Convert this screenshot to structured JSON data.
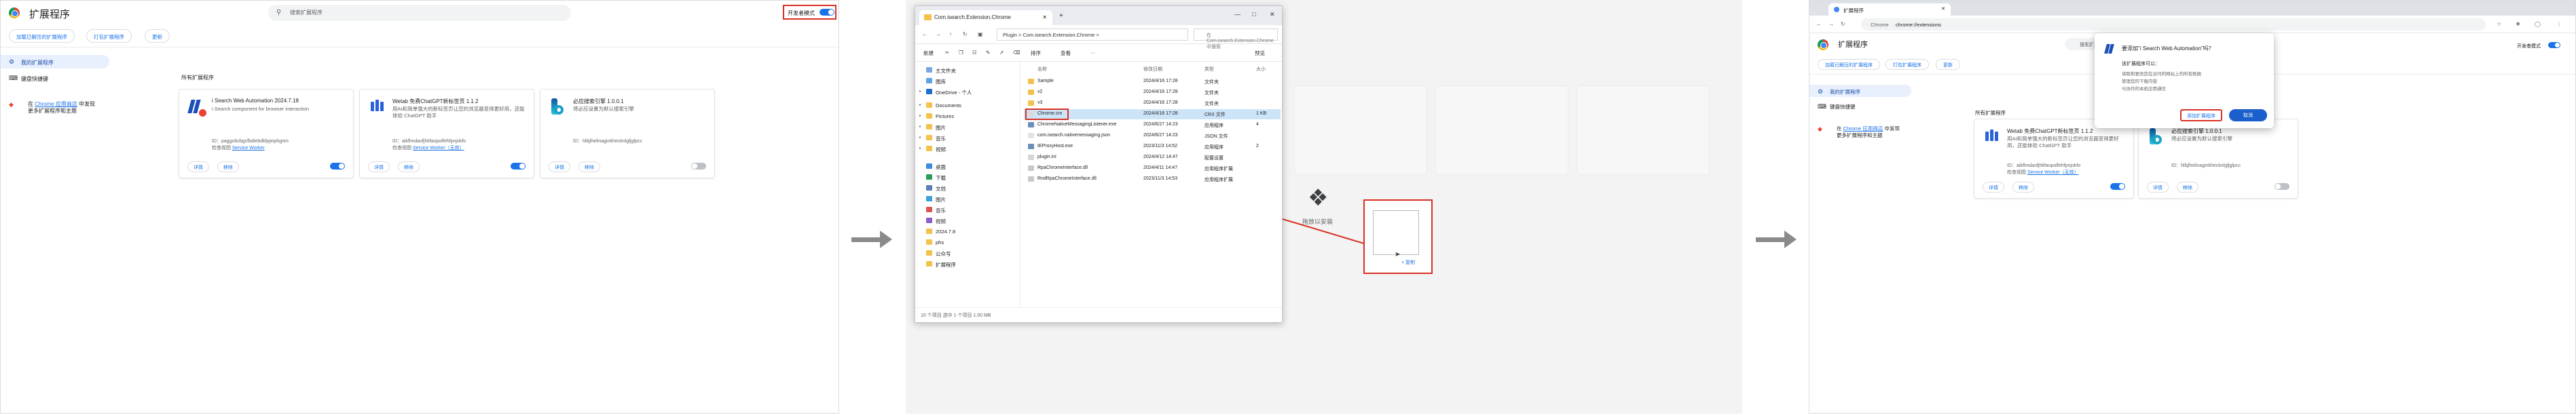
{
  "panel1": {
    "title": "扩展程序",
    "search_placeholder": "搜索扩展程序",
    "dev_mode_label": "开发者模式",
    "buttons": [
      "加载已解压的扩展程序",
      "打包扩展程序",
      "更新"
    ],
    "nav": [
      "我的扩展程序",
      "键盘快捷键"
    ],
    "store_note_line1": "在 ",
    "store_note_link": "Chrome 应用商店",
    "store_note_line1_end": " 中发现",
    "store_note_line2": "更多扩展程序和主题",
    "section_title": "所有扩展程序",
    "cards": [
      {
        "name": "i Search Web Automation  2024.7.18",
        "desc": "i Search component for browser interaction",
        "id": "ID：paggobcbgcfbdiebdkfpjeiphgnm",
        "view": "检查视图 ",
        "view_link": "Service Worker",
        "details": "详情",
        "remove": "移除",
        "enabled": true
      },
      {
        "name": "Wetab 免费ChatGPT新标签页  1.1.2",
        "desc": "用AI和简单强大的新标签页让您的浏览器变得更好用，还能体验 ChatGPT 助手",
        "id": "ID：aikflmdaofjhkfaopolfehfpnjokfo",
        "view": "检查视图 ",
        "view_link": "Service Worker（无效）",
        "details": "详情",
        "remove": "移除",
        "enabled": true
      },
      {
        "name": "必应搜索引擎  1.0.0.1",
        "desc": "将必应设置为默认搜索引擎",
        "id": "ID：hlbjlhelinaginkhecknlgfjglpcc",
        "view": "",
        "view_link": "",
        "details": "详情",
        "remove": "移除",
        "enabled": false
      }
    ]
  },
  "panel2": {
    "drop_label": "拖放以安装",
    "copy_hint": "+ 复制",
    "explorer": {
      "tab_title": "Com.isearch.Extension.Chrome",
      "path": [
        "Plugin",
        ">",
        "Com.isearch.Extension.Chrome",
        ">"
      ],
      "search_placeholder": "在 Com.isearch.Extension.Chrome 中搜索",
      "tools": [
        "新建",
        "排序",
        "查看",
        "···",
        "预览"
      ],
      "sidebar": [
        "主文件夹",
        "图库",
        "OneDrive - 个人",
        "Documents",
        "Pictures",
        "图片",
        "音乐",
        "视频",
        "桌面",
        "下载",
        "文档",
        "图片",
        "音乐",
        "视频",
        "2024.7.8",
        "phs",
        "公众号",
        "扩展程序"
      ],
      "columns": [
        "名称",
        "修改日期",
        "类型",
        "大小"
      ],
      "files": [
        {
          "name": "Sample",
          "date": "2024/4/16 17:28",
          "type": "文件夹",
          "size": ""
        },
        {
          "name": "v2",
          "date": "2024/4/16 17:28",
          "type": "文件夹",
          "size": ""
        },
        {
          "name": "v3",
          "date": "2024/4/16 17:28",
          "type": "文件夹",
          "size": ""
        },
        {
          "name": "Chrome.crx",
          "date": "2024/4/16 17:28",
          "type": "CRX 文件",
          "size": "1 KB"
        },
        {
          "name": "ChromeNativeMessagingListener.exe",
          "date": "2024/6/27 14:23",
          "type": "应用程序",
          "size": "4"
        },
        {
          "name": "com.isearch.nativemessaging.json",
          "date": "2024/6/27 14:23",
          "type": "JSON 文件",
          "size": ""
        },
        {
          "name": "IEProxyHost.exe",
          "date": "2023/11/3 14:52",
          "type": "应用程序",
          "size": "2"
        },
        {
          "name": "plugin.ini",
          "date": "2024/4/12 14:47",
          "type": "配置设置",
          "size": ""
        },
        {
          "name": "RpaChromeInterface.dll",
          "date": "2024/4/11 14:47",
          "type": "应用程序扩展",
          "size": ""
        },
        {
          "name": "RndRpaChromeInterface.dll",
          "date": "2023/11/3 14:53",
          "type": "应用程序扩展",
          "size": ""
        }
      ],
      "status": "10 个项目    选中 1 个项目  1.00 MB"
    }
  },
  "panel3": {
    "tab_title": "扩展程序",
    "omnibox_prefix": "Chrome",
    "omnibox_url": "chrome://extensions",
    "title": "扩展程序",
    "search_placeholder": "搜索扩展程序",
    "dev_mode_label": "开发者模式",
    "buttons": [
      "加载已解压的扩展程序",
      "打包扩展程序",
      "更新"
    ],
    "nav": [
      "我的扩展程序",
      "键盘快捷键"
    ],
    "store_note_line1": "在 ",
    "store_note_link": "Chrome 应用商店",
    "store_note_line1_end": " 中发现",
    "store_note_line2": "更多扩展程序和主题",
    "section_title": "所有扩展程序",
    "cards": [
      {
        "name": "Wetab 免费ChatGPT新标签页  1.1.2",
        "desc": "用AI和简单强大的新标签页让您的浏览器变得更好用，还能体验 ChatGPT 助手",
        "id": "ID：aikflmdaofjhkfaopolfehfpnjokfo",
        "view": "检查视图 ",
        "view_link": "Service Worker（无效）",
        "details": "详情",
        "remove": "移除",
        "enabled": true
      },
      {
        "name": "必应搜索引擎  1.0.0.1",
        "desc": "将必应设置为默认搜索引擎",
        "id": "ID：hlbjlhelinaginkhecknlgfjglpcc",
        "details": "详情",
        "remove": "移除",
        "enabled": false
      }
    ],
    "dialog": {
      "title": "要添加\"i Search Web Automation\"吗？",
      "sub": "该扩展程序可以：",
      "perms": [
        "读取和更改您在访问的网站上的所有数据",
        "管理您的下载内容",
        "与协作的本机应用通信"
      ],
      "add": "添加扩展程序",
      "cancel": "取消"
    }
  }
}
